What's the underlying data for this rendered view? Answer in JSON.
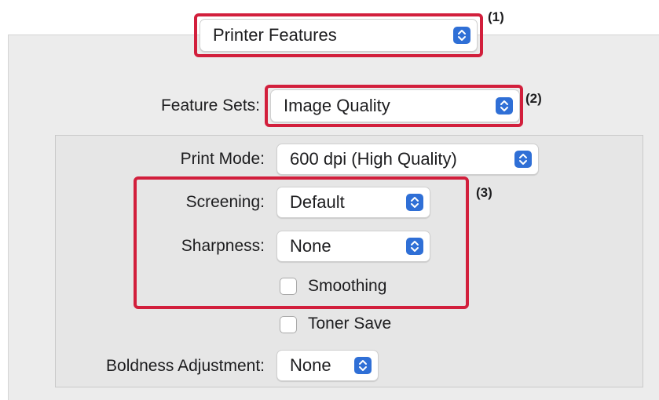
{
  "panel_select": {
    "value": "Printer Features"
  },
  "feature_sets": {
    "label": "Feature Sets:",
    "value": "Image Quality"
  },
  "print_mode": {
    "label": "Print Mode:",
    "value": "600 dpi (High Quality)"
  },
  "screening": {
    "label": "Screening:",
    "value": "Default"
  },
  "sharpness": {
    "label": "Sharpness:",
    "value": "None"
  },
  "smoothing": {
    "label": "Smoothing",
    "checked": false
  },
  "toner_save": {
    "label": "Toner Save",
    "checked": false
  },
  "boldness": {
    "label": "Boldness Adjustment:",
    "value": "None"
  },
  "callouts": {
    "c1": "(1)",
    "c2": "(2)",
    "c3": "(3)",
    "color": "#d21f3c"
  },
  "colors": {
    "accent": "#2f6fd6"
  }
}
